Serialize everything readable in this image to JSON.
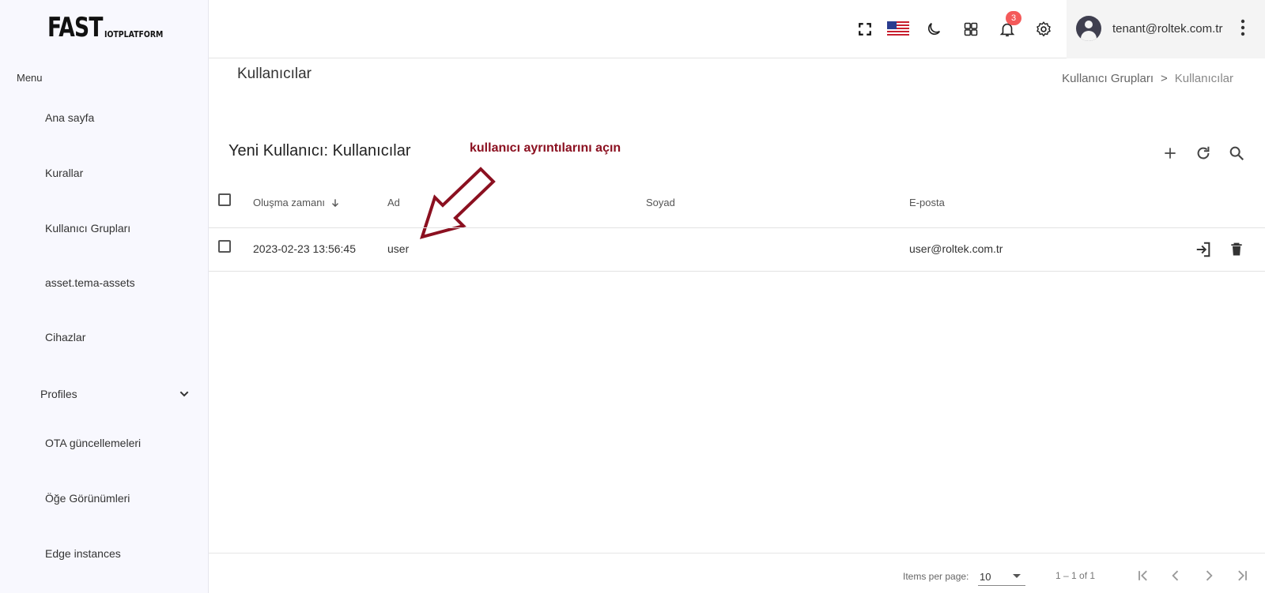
{
  "logo": {
    "big": "FAST",
    "small": "IOTPLATFORM"
  },
  "sidebar": {
    "menu_label": "Menu",
    "items": [
      {
        "label": "Ana sayfa"
      },
      {
        "label": "Kurallar"
      },
      {
        "label": "Kullanıcı Grupları"
      },
      {
        "label": "asset.tema-assets"
      },
      {
        "label": "Cihazlar"
      },
      {
        "label": "Profiles"
      },
      {
        "label": "OTA güncellemeleri"
      },
      {
        "label": "Öğe Görünümleri"
      },
      {
        "label": "Edge instances"
      }
    ]
  },
  "header": {
    "icons": [
      "fullscreen-icon",
      "us-flag-icon",
      "moon-icon",
      "apps-grid-icon",
      "bell-icon",
      "gear-icon"
    ],
    "notification_count": "3",
    "user_email": "tenant@roltek.com.tr"
  },
  "page": {
    "title": "Kullanıcılar",
    "breadcrumb": {
      "parent": "Kullanıcı Grupları",
      "separator": ">",
      "current": "Kullanıcılar"
    }
  },
  "table": {
    "title": "Yeni Kullanıcı: Kullanıcılar",
    "annotation": "kullanıcı ayrıntılarını açın",
    "columns": {
      "created": "Oluşma zamanı",
      "first_name": "Ad",
      "last_name": "Soyad",
      "email": "E-posta"
    },
    "rows": [
      {
        "created": "2023-02-23 13:56:45",
        "first_name": "user",
        "last_name": "",
        "email": "user@roltek.com.tr"
      }
    ]
  },
  "paginator": {
    "items_per_page_label": "Items per page:",
    "items_per_page_value": "10",
    "range_label": "1 – 1 of 1"
  },
  "colors": {
    "annotation": "#8b1020",
    "badge": "#f45a5a",
    "sidebar_bg": "#f8f8fe"
  }
}
